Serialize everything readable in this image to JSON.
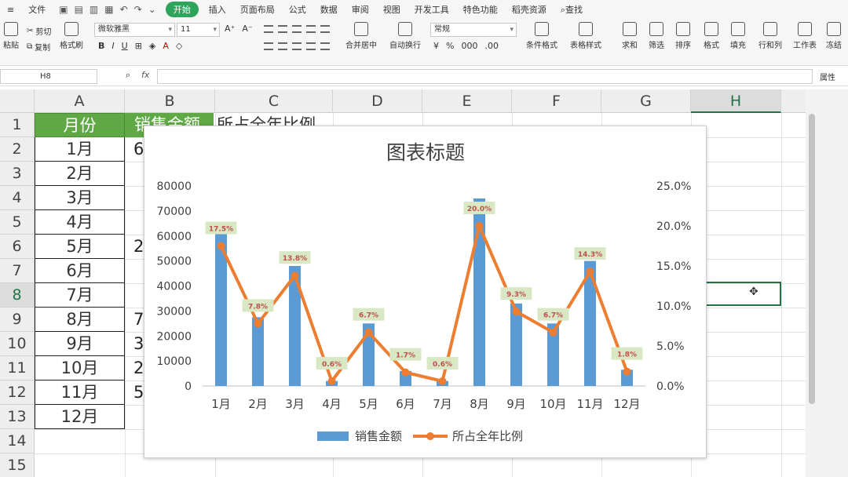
{
  "menubar": {
    "file": "文件",
    "tabs": [
      "开始",
      "插入",
      "页面布局",
      "公式",
      "数据",
      "审阅",
      "视图",
      "开发工具",
      "特色功能",
      "稻壳资源"
    ],
    "search": "查找"
  },
  "ribbon": {
    "paste": "粘贴",
    "cut": "剪切",
    "copy": "复制",
    "format_painter": "格式刷",
    "font_name": "微软雅黑",
    "font_size": "11",
    "merge": "合并居中",
    "wrap": "自动换行",
    "number_format": "常规",
    "conditional": "条件格式",
    "table_style": "表格样式",
    "sum": "求和",
    "filter": "筛选",
    "sort": "排序",
    "format": "格式",
    "fill": "填充",
    "rowcol": "行和列",
    "sheet": "工作表",
    "freeze": "冻结"
  },
  "formula": {
    "name_box": "H8",
    "fx": "fx",
    "attr": "属性"
  },
  "sheet": {
    "columns": [
      "A",
      "B",
      "C",
      "D",
      "E",
      "F",
      "G",
      "H"
    ],
    "rows": [
      "1",
      "2",
      "3",
      "4",
      "5",
      "6",
      "7",
      "8",
      "9",
      "10",
      "11",
      "12",
      "13",
      "14",
      "15"
    ],
    "headers": {
      "a": "月份",
      "b": "销售金额",
      "c": "所占全年比例"
    },
    "months": [
      "1月",
      "2月",
      "3月",
      "4月",
      "5月",
      "6月",
      "7月",
      "8月",
      "9月",
      "10月",
      "11月",
      "12月"
    ],
    "b_peek": [
      "6",
      "",
      "",
      "",
      "2",
      "",
      "",
      "7",
      "3",
      "2",
      "5",
      ""
    ]
  },
  "chart_data": {
    "type": "bar",
    "title": "图表标题",
    "categories": [
      "1月",
      "2月",
      "3月",
      "4月",
      "5月",
      "6月",
      "7月",
      "8月",
      "9月",
      "10月",
      "11月",
      "12月"
    ],
    "series": [
      {
        "name": "销售金额",
        "type": "bar",
        "axis": "left",
        "values": [
          65000,
          27500,
          48000,
          2000,
          25000,
          6000,
          2000,
          75000,
          33000,
          25000,
          50000,
          6500
        ],
        "color": "#5b9bd5"
      },
      {
        "name": "所占全年比例",
        "type": "line",
        "axis": "right",
        "values": [
          17.5,
          7.8,
          13.8,
          0.6,
          6.7,
          1.7,
          0.6,
          20.0,
          9.3,
          6.7,
          14.3,
          1.8
        ],
        "color": "#ed7d31"
      }
    ],
    "data_labels": [
      "17.5%",
      "7.8%",
      "13.8%",
      "0.6%",
      "6.7%",
      "1.7%",
      "0.6%",
      "20.0%",
      "9.3%",
      "6.7%",
      "14.3%",
      "1.8%"
    ],
    "ylim": [
      0,
      80000
    ],
    "yticks": [
      "0",
      "10000",
      "20000",
      "30000",
      "40000",
      "50000",
      "60000",
      "70000",
      "80000"
    ],
    "y2lim": [
      0,
      25
    ],
    "y2ticks": [
      "0.0%",
      "5.0%",
      "10.0%",
      "15.0%",
      "20.0%",
      "25.0%"
    ],
    "grid": false,
    "legend": "bottom",
    "label_color": "#c0504d",
    "label_bg": "#d8e8c4"
  }
}
